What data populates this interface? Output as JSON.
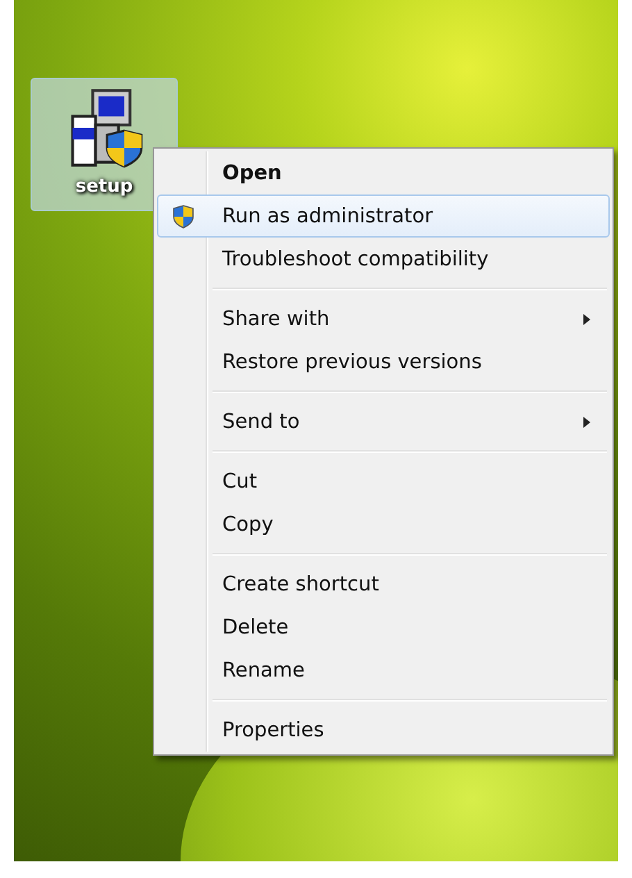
{
  "desktop_icon": {
    "label": "setup",
    "selected": true
  },
  "context_menu": {
    "groups": [
      {
        "items": [
          {
            "label": "Open",
            "kind": "plain",
            "default": true,
            "selected": false,
            "submenu": false
          },
          {
            "label": "Run as administrator",
            "kind": "elevated",
            "default": false,
            "selected": true,
            "submenu": false
          },
          {
            "label": "Troubleshoot compatibility",
            "kind": "plain",
            "default": false,
            "selected": false,
            "submenu": false
          }
        ]
      },
      {
        "items": [
          {
            "label": "Share with",
            "kind": "plain",
            "default": false,
            "selected": false,
            "submenu": true
          },
          {
            "label": "Restore previous versions",
            "kind": "plain",
            "default": false,
            "selected": false,
            "submenu": false
          }
        ]
      },
      {
        "items": [
          {
            "label": "Send to",
            "kind": "plain",
            "default": false,
            "selected": false,
            "submenu": true
          }
        ]
      },
      {
        "items": [
          {
            "label": "Cut",
            "kind": "plain",
            "default": false,
            "selected": false,
            "submenu": false
          },
          {
            "label": "Copy",
            "kind": "plain",
            "default": false,
            "selected": false,
            "submenu": false
          }
        ]
      },
      {
        "items": [
          {
            "label": "Create shortcut",
            "kind": "plain",
            "default": false,
            "selected": false,
            "submenu": false
          },
          {
            "label": "Delete",
            "kind": "plain",
            "default": false,
            "selected": false,
            "submenu": false
          },
          {
            "label": "Rename",
            "kind": "plain",
            "default": false,
            "selected": false,
            "submenu": false
          }
        ]
      },
      {
        "items": [
          {
            "label": "Properties",
            "kind": "plain",
            "default": false,
            "selected": false,
            "submenu": false
          }
        ]
      }
    ]
  }
}
